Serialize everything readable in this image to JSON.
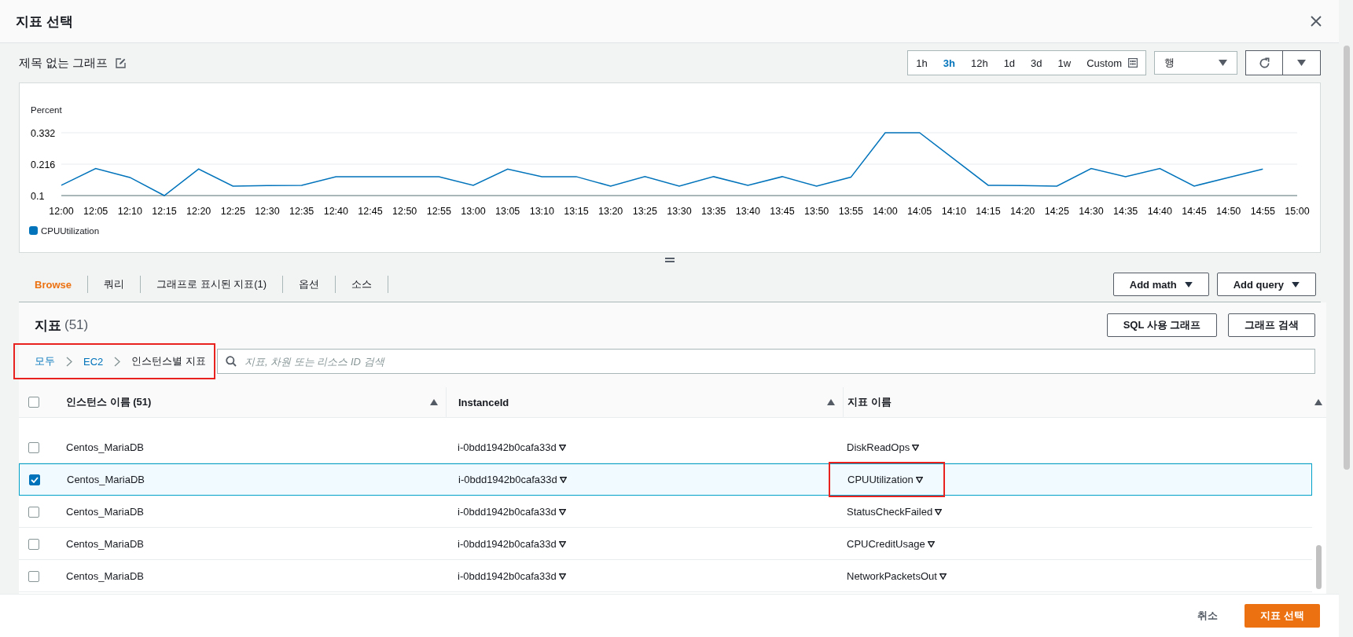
{
  "dialog": {
    "title": "지표 선택"
  },
  "graph": {
    "title": "제목 없는 그래프",
    "time_ranges": [
      {
        "label": "1h",
        "selected": false
      },
      {
        "label": "3h",
        "selected": true
      },
      {
        "label": "12h",
        "selected": false
      },
      {
        "label": "1d",
        "selected": false
      },
      {
        "label": "3d",
        "selected": false
      },
      {
        "label": "1w",
        "selected": false
      },
      {
        "label": "Custom",
        "selected": false
      }
    ],
    "view_select": {
      "value": "행"
    },
    "chart_data": {
      "type": "line",
      "ylabel": "Percent",
      "categories": [
        "12:00",
        "12:05",
        "12:10",
        "12:15",
        "12:20",
        "12:25",
        "12:30",
        "12:35",
        "12:40",
        "12:45",
        "12:50",
        "12:55",
        "13:00",
        "13:05",
        "13:10",
        "13:15",
        "13:20",
        "13:25",
        "13:30",
        "13:35",
        "13:40",
        "13:45",
        "13:50",
        "13:55",
        "14:00",
        "14:05",
        "14:10",
        "14:15",
        "14:20",
        "14:25",
        "14:30",
        "14:35",
        "14:40",
        "14:45",
        "14:50",
        "14:55",
        "15:00"
      ],
      "series": [
        {
          "name": "CPUUtilization",
          "color": "#0073bb",
          "values": [
            0.138,
            0.2,
            0.167,
            0.1,
            0.198,
            0.135,
            0.137,
            0.138,
            0.17,
            0.17,
            0.17,
            0.17,
            0.138,
            0.198,
            0.17,
            0.17,
            0.135,
            0.17,
            0.135,
            0.17,
            0.138,
            0.17,
            0.135,
            0.168,
            0.332,
            0.332,
            0.235,
            0.138,
            0.137,
            0.135,
            0.2,
            0.17,
            0.2,
            0.135,
            0.167,
            0.198,
            null
          ]
        }
      ],
      "ylim": [
        0.1,
        0.332
      ],
      "yticks": [
        0.1,
        0.216,
        0.332
      ]
    }
  },
  "tabs": [
    {
      "label": "Browse",
      "selected": true
    },
    {
      "label": "쿼리",
      "selected": false
    },
    {
      "label": "그래프로 표시된 지표(1)",
      "selected": false
    },
    {
      "label": "옵션",
      "selected": false
    },
    {
      "label": "소스",
      "selected": false
    }
  ],
  "tab_actions": [
    "Add math",
    "Add query"
  ],
  "metrics": {
    "title": "지표",
    "count": "(51)",
    "actions": [
      "SQL 사용 그래프",
      "그래프 검색"
    ],
    "breadcrumb": {
      "highlighted": true,
      "items": [
        {
          "label": "모두",
          "kind": "link"
        },
        {
          "label": "EC2",
          "kind": "link"
        },
        {
          "label": "인스턴스별 지표",
          "kind": "current"
        }
      ]
    },
    "search": {
      "placeholder": "지표, 차원 또는 리소스 ID 검색"
    },
    "table": {
      "select_all_checked": false,
      "columns": [
        "인스턴스 이름 (51)",
        "InstanceId",
        "지표 이름"
      ],
      "rows": [
        {
          "selected": false,
          "highlighted": false,
          "instance_name": "Centos_MariaDB",
          "instance_id": "i-0bdd1942b0cafa33d",
          "metric_name": "DiskReadOps"
        },
        {
          "selected": true,
          "highlighted": true,
          "instance_name": "Centos_MariaDB",
          "instance_id": "i-0bdd1942b0cafa33d",
          "metric_name": "CPUUtilization"
        },
        {
          "selected": false,
          "highlighted": false,
          "instance_name": "Centos_MariaDB",
          "instance_id": "i-0bdd1942b0cafa33d",
          "metric_name": "StatusCheckFailed"
        },
        {
          "selected": false,
          "highlighted": false,
          "instance_name": "Centos_MariaDB",
          "instance_id": "i-0bdd1942b0cafa33d",
          "metric_name": "CPUCreditUsage"
        },
        {
          "selected": false,
          "highlighted": false,
          "instance_name": "Centos_MariaDB",
          "instance_id": "i-0bdd1942b0cafa33d",
          "metric_name": "NetworkPacketsOut"
        }
      ]
    }
  },
  "footer": {
    "buttons": [
      {
        "label": "취소",
        "kind": "secondary"
      },
      {
        "label": "지표 선택",
        "kind": "primary"
      }
    ]
  }
}
